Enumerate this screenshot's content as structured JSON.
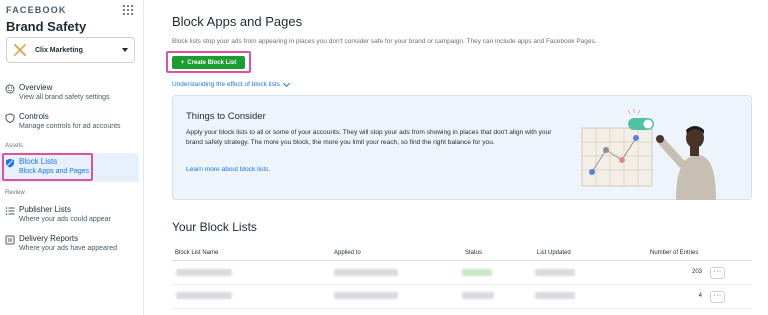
{
  "sidebar": {
    "brand": "FACEBOOK",
    "title": "Brand Safety",
    "account_name": "Clix Marketing",
    "items": [
      {
        "title": "Overview",
        "subtitle": "View all brand safety settings"
      },
      {
        "title": "Controls",
        "subtitle": "Manage controls for ad accounts"
      },
      {
        "title": "Block Lists",
        "subtitle": "Block Apps and Pages"
      },
      {
        "title": "Publisher Lists",
        "subtitle": "Where your ads could appear"
      },
      {
        "title": "Delivery Reports",
        "subtitle": "Where your ads have appeared"
      }
    ],
    "sections": {
      "assets": "Assets",
      "review": "Review"
    }
  },
  "main": {
    "title": "Block Apps and Pages",
    "description": "Block lists stop your ads from appearing in places you don't consider safe for your brand or campaign. They can include apps and Facebook Pages.",
    "create_button": "Create Block List",
    "understand_link": "Understanding the effect of block lists",
    "consider": {
      "title": "Things to Consider",
      "body": "Apply your block lists to all or some of your accounts. They will stop your ads from showing in places that don't align with your brand safety strategy. The more you block, the more you limit your reach, so find the right balance for you.",
      "link": "Learn more about block lists."
    },
    "lists_title": "Your Block Lists",
    "table": {
      "headers": [
        "Block List Name",
        "Applied to",
        "Status",
        "List Updated",
        "Number of Entries"
      ],
      "rows": [
        {
          "entries": "203"
        },
        {
          "entries": "4"
        }
      ]
    }
  },
  "colors": {
    "accent": "#1877f2",
    "create_button": "#1a9e2f",
    "highlight": "#e0529c"
  }
}
